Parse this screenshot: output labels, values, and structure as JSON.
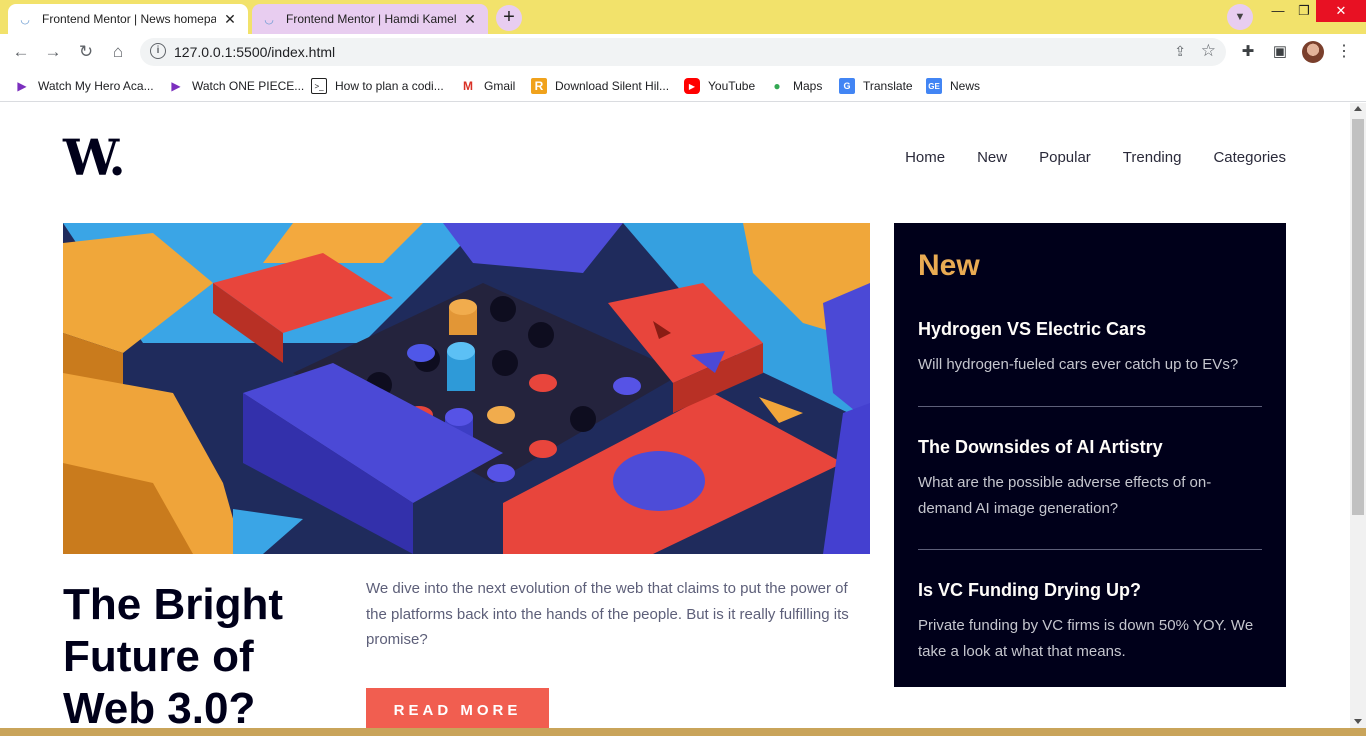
{
  "browser": {
    "tabs": [
      {
        "title": "Frontend Mentor | News homepa",
        "active": true
      },
      {
        "title": "Frontend Mentor | Hamdi Kamel",
        "active": false
      }
    ],
    "new_tab_label": "+",
    "url": "127.0.0.1:5500/index.html",
    "bookmarks": [
      {
        "label": "Watch My Hero Aca...",
        "icon": "play-icon"
      },
      {
        "label": "Watch ONE PIECE...",
        "icon": "play-icon"
      },
      {
        "label": "How to plan a codi...",
        "icon": "terminal-icon"
      },
      {
        "label": "Gmail",
        "icon": "gmail-icon"
      },
      {
        "label": "Download Silent Hil...",
        "icon": "r-icon"
      },
      {
        "label": "YouTube",
        "icon": "youtube-icon"
      },
      {
        "label": "Maps",
        "icon": "maps-icon"
      },
      {
        "label": "Translate",
        "icon": "translate-icon"
      },
      {
        "label": "News",
        "icon": "news-icon"
      }
    ]
  },
  "site": {
    "logo": "W.",
    "nav": [
      "Home",
      "New",
      "Popular",
      "Trending",
      "Categories"
    ],
    "hero": {
      "headline": "The Bright Future of Web 3.0?",
      "lead": "We dive into the next evolution of the web that claims to put the power of the platforms back into the hands of the people. But is it really fulfilling its promise?",
      "cta": "READ MORE"
    },
    "new_panel": {
      "heading": "New",
      "items": [
        {
          "title": "Hydrogen VS Electric Cars",
          "desc": "Will hydrogen-fueled cars ever catch up to EVs?"
        },
        {
          "title": "The Downsides of AI Artistry",
          "desc": "What are the possible adverse effects of on-demand AI image generation?"
        },
        {
          "title": "Is VC Funding Drying Up?",
          "desc": "Private funding by VC firms is down 50% YOY. We take a look at what that means."
        }
      ]
    }
  },
  "colors": {
    "tab_strip": "#f2e26b",
    "soft_red": "#f15e50",
    "soft_orange": "#e9ab53",
    "very_dark_blue": "#00001a",
    "grayish_blue": "#5d5f79"
  }
}
